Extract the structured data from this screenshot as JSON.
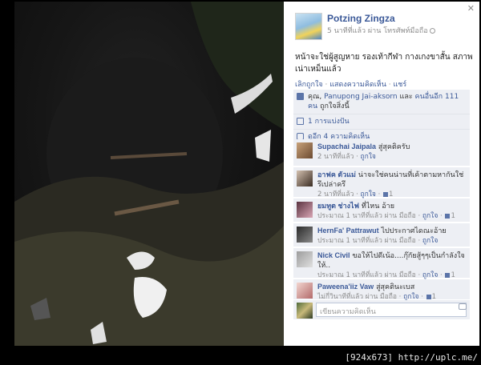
{
  "author": {
    "name": "Potzing Zingza",
    "meta": "5 นาทีที่แล้ว ผ่าน โทรศัพท์มือถือ"
  },
  "post": {
    "text": "หน้าจะใช่ผู้สูญหาย รองเท้ากีฬา กางเกงขาสั้น สภาพเน่าเหม็นแล้ว"
  },
  "actions": {
    "unlike": "เลิกถูกใจ",
    "comment": "แสดงความคิดเห็น",
    "share": "แชร์",
    "separator": "·"
  },
  "likes": {
    "you": "คุณ,",
    "friend": "Panupong Jai-aksorn",
    "and": "และ",
    "others": "คนอื่นอีก 111 คน",
    "suffix": "ถูกใจสิ่งนี้"
  },
  "shares": {
    "text": "1 การแบ่งปัน"
  },
  "more_comments": {
    "text": "ดูอีก 4 ความคิดเห็น"
  },
  "comments": [
    {
      "name": "Supachai Jaipala",
      "text": "สู่สุคติครับ",
      "time": "2 นาทีที่แล้ว",
      "like": "ถูกใจ",
      "likes": ""
    },
    {
      "name": "อาฟค ตัวแม่",
      "text": "น่าจะใช่คนน่านที่เค้าตามหากันใช่รึเปล่าครึ",
      "time": "2 นาทีที่แล้ว",
      "like": "ถูกใจ",
      "likes": "1"
    },
    {
      "name": "ยมทูต ช่างไฟ",
      "text": "ที่ไหน อ้าย",
      "time": "ประมาณ 1 นาทีที่แล้ว ผ่าน มือถือ",
      "like": "ถูกใจ",
      "likes": "1"
    },
    {
      "name": "HernFa' Pattrawut",
      "text": "ไปประกาศไดณะอ้าย",
      "time": "ประมาณ 1 นาทีที่แล้ว ผ่าน มือถือ",
      "like": "ถูกใจ",
      "likes": ""
    },
    {
      "name": "Nick Civil",
      "text": "ขอให้ไปดีเน้อ....กุ๊กัยสู้ๆๆเป็นกำลังใจให้..",
      "time": "ประมาณ 1 นาทีที่แล้ว ผ่าน มือถือ",
      "like": "ถูกใจ",
      "likes": "1"
    },
    {
      "name": "Paweena'iiz Vaw",
      "text": "สู่สุคตินะเบส",
      "time": "ไม่กี่วินาทีที่แล้ว ผ่าน มือถือ",
      "like": "ถูกใจ",
      "likes": "1"
    }
  ],
  "reply": {
    "placeholder": "เขียนความคิดเห็น"
  },
  "icons": {
    "close": "close-icon",
    "globe": "globe-icon",
    "like": "thumbs-up-icon",
    "share": "share-icon",
    "comment": "comment-icon",
    "camera": "camera-icon"
  },
  "colors": {
    "link": "#3b5998",
    "panel_bg": "#edeff4",
    "meta": "#8d8d8d"
  },
  "watermark": {
    "text": "[924x673] http://uplc.me/"
  }
}
